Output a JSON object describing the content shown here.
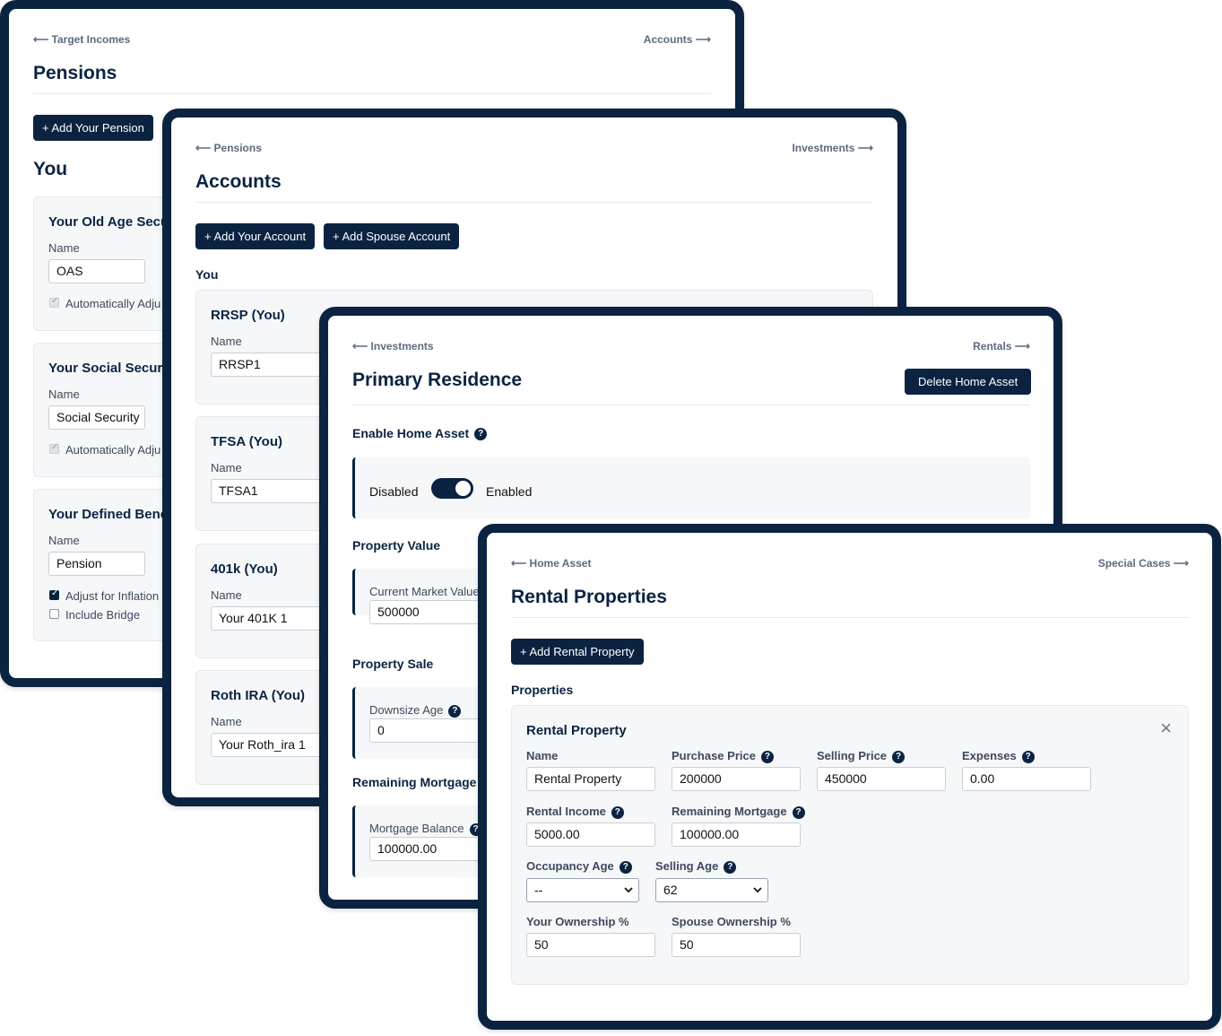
{
  "pensions": {
    "nav_prev": "⟵ Target Incomes",
    "nav_next": "Accounts ⟶",
    "title": "Pensions",
    "add_button": "+ Add Your Pension",
    "section": "You",
    "cards": [
      {
        "title": "Your Old Age Secur",
        "name_label": "Name",
        "name_value": "OAS",
        "check1": "Automatically Adju"
      },
      {
        "title": "Your Social Securit",
        "name_label": "Name",
        "name_value": "Social Security",
        "check1": "Automatically Adju"
      },
      {
        "title": "Your Defined Benef",
        "name_label": "Name",
        "name_value": "Pension",
        "check1": "Adjust for Inflation",
        "check2": "Include Bridge"
      }
    ]
  },
  "accounts": {
    "nav_prev": "⟵ Pensions",
    "nav_next": "Investments ⟶",
    "title": "Accounts",
    "add_button": "+ Add Your Account",
    "add_spouse_button": "+ Add Spouse Account",
    "section": "You",
    "cards": [
      {
        "title": "RRSP (You)",
        "name_label": "Name",
        "name_value": "RRSP1"
      },
      {
        "title": "TFSA (You)",
        "name_label": "Name",
        "name_value": "TFSA1"
      },
      {
        "title": "401k (You)",
        "name_label": "Name",
        "name_value": "Your 401K 1"
      },
      {
        "title": "Roth IRA (You)",
        "name_label": "Name",
        "name_value": "Your Roth_ira 1"
      }
    ]
  },
  "home": {
    "nav_prev": "⟵ Investments",
    "nav_next": "Rentals ⟶",
    "title": "Primary Residence",
    "delete_button": "Delete Home Asset",
    "enable_label": "Enable Home Asset",
    "toggle_off": "Disabled",
    "toggle_on": "Enabled",
    "property_value_heading": "Property Value",
    "market_value_label": "Current Market Value",
    "market_value": "500000",
    "property_sale_heading": "Property Sale",
    "downsize_label": "Downsize Age",
    "downsize_value": "0",
    "mortgage_heading": "Remaining Mortgage",
    "mortgage_label": "Mortgage Balance",
    "mortgage_value": "100000.00"
  },
  "rentals": {
    "nav_prev": "⟵ Home Asset",
    "nav_next": "Special Cases ⟶",
    "title": "Rental Properties",
    "add_button": "+ Add Rental Property",
    "section": "Properties",
    "card": {
      "title": "Rental Property",
      "name_label": "Name",
      "name_value": "Rental Property",
      "purchase_label": "Purchase Price",
      "purchase_value": "200000",
      "selling_label": "Selling Price",
      "selling_value": "450000",
      "expenses_label": "Expenses",
      "expenses_value": "0.00",
      "income_label": "Rental Income",
      "income_value": "5000.00",
      "mortgage_label": "Remaining Mortgage",
      "mortgage_value": "100000.00",
      "occupancy_label": "Occupancy Age",
      "occupancy_value": "--",
      "selling_age_label": "Selling Age",
      "selling_age_value": "62",
      "own_label": "Your Ownership %",
      "own_value": "50",
      "spouse_label": "Spouse Ownership %",
      "spouse_value": "50"
    }
  },
  "icons": {
    "help": "?",
    "close": "×",
    "chevron": "⌄"
  },
  "colors": {
    "navy": "#0b2341",
    "card_bg": "#f6f7f9"
  }
}
